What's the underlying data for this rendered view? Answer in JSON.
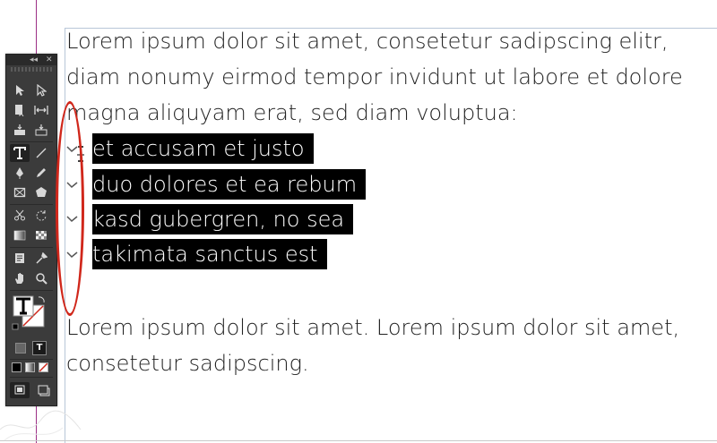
{
  "document": {
    "paragraph1": [
      "Lorem ipsum dolor sit amet, consetetur sadipscing elitr,",
      "diam nonumy eirmod tempor invidunt ut labore et dolore",
      "magna aliquyam erat, sed diam voluptua:"
    ],
    "bullets": [
      "et accusam et justo",
      "duo dolores et ea rebum",
      "kasd gubergren, no sea",
      "takimata sanctus est"
    ],
    "paragraph2": [
      "Lorem ipsum dolor sit amet. Lorem ipsum dolor sit amet,",
      "consetetur sadipscing."
    ]
  },
  "tools_panel": {
    "collapse_label": "◂◂",
    "close_label": "✕",
    "tools": [
      [
        "selection-tool-icon",
        "direct-selection-tool-icon"
      ],
      [
        "page-tool-icon",
        "gap-tool-icon"
      ],
      [
        "content-collector-icon",
        "content-placer-icon"
      ],
      [
        "type-tool-icon",
        "line-tool-icon"
      ],
      [
        "pen-tool-icon",
        "pencil-tool-icon"
      ],
      [
        "rectangle-frame-tool-icon",
        "polygon-tool-icon"
      ],
      [
        "scissors-tool-icon",
        "free-transform-tool-icon"
      ],
      [
        "gradient-swatch-tool-icon",
        "gradient-feather-tool-icon"
      ],
      [
        "note-tool-icon",
        "eyedropper-tool-icon"
      ],
      [
        "hand-tool-icon",
        "zoom-tool-icon"
      ]
    ],
    "active_tool": "type-tool-icon"
  },
  "colors": {
    "highlight": "#000000",
    "guide": "#9b2f86",
    "annotation": "#d0271b",
    "panel": "#3b3b3b"
  }
}
